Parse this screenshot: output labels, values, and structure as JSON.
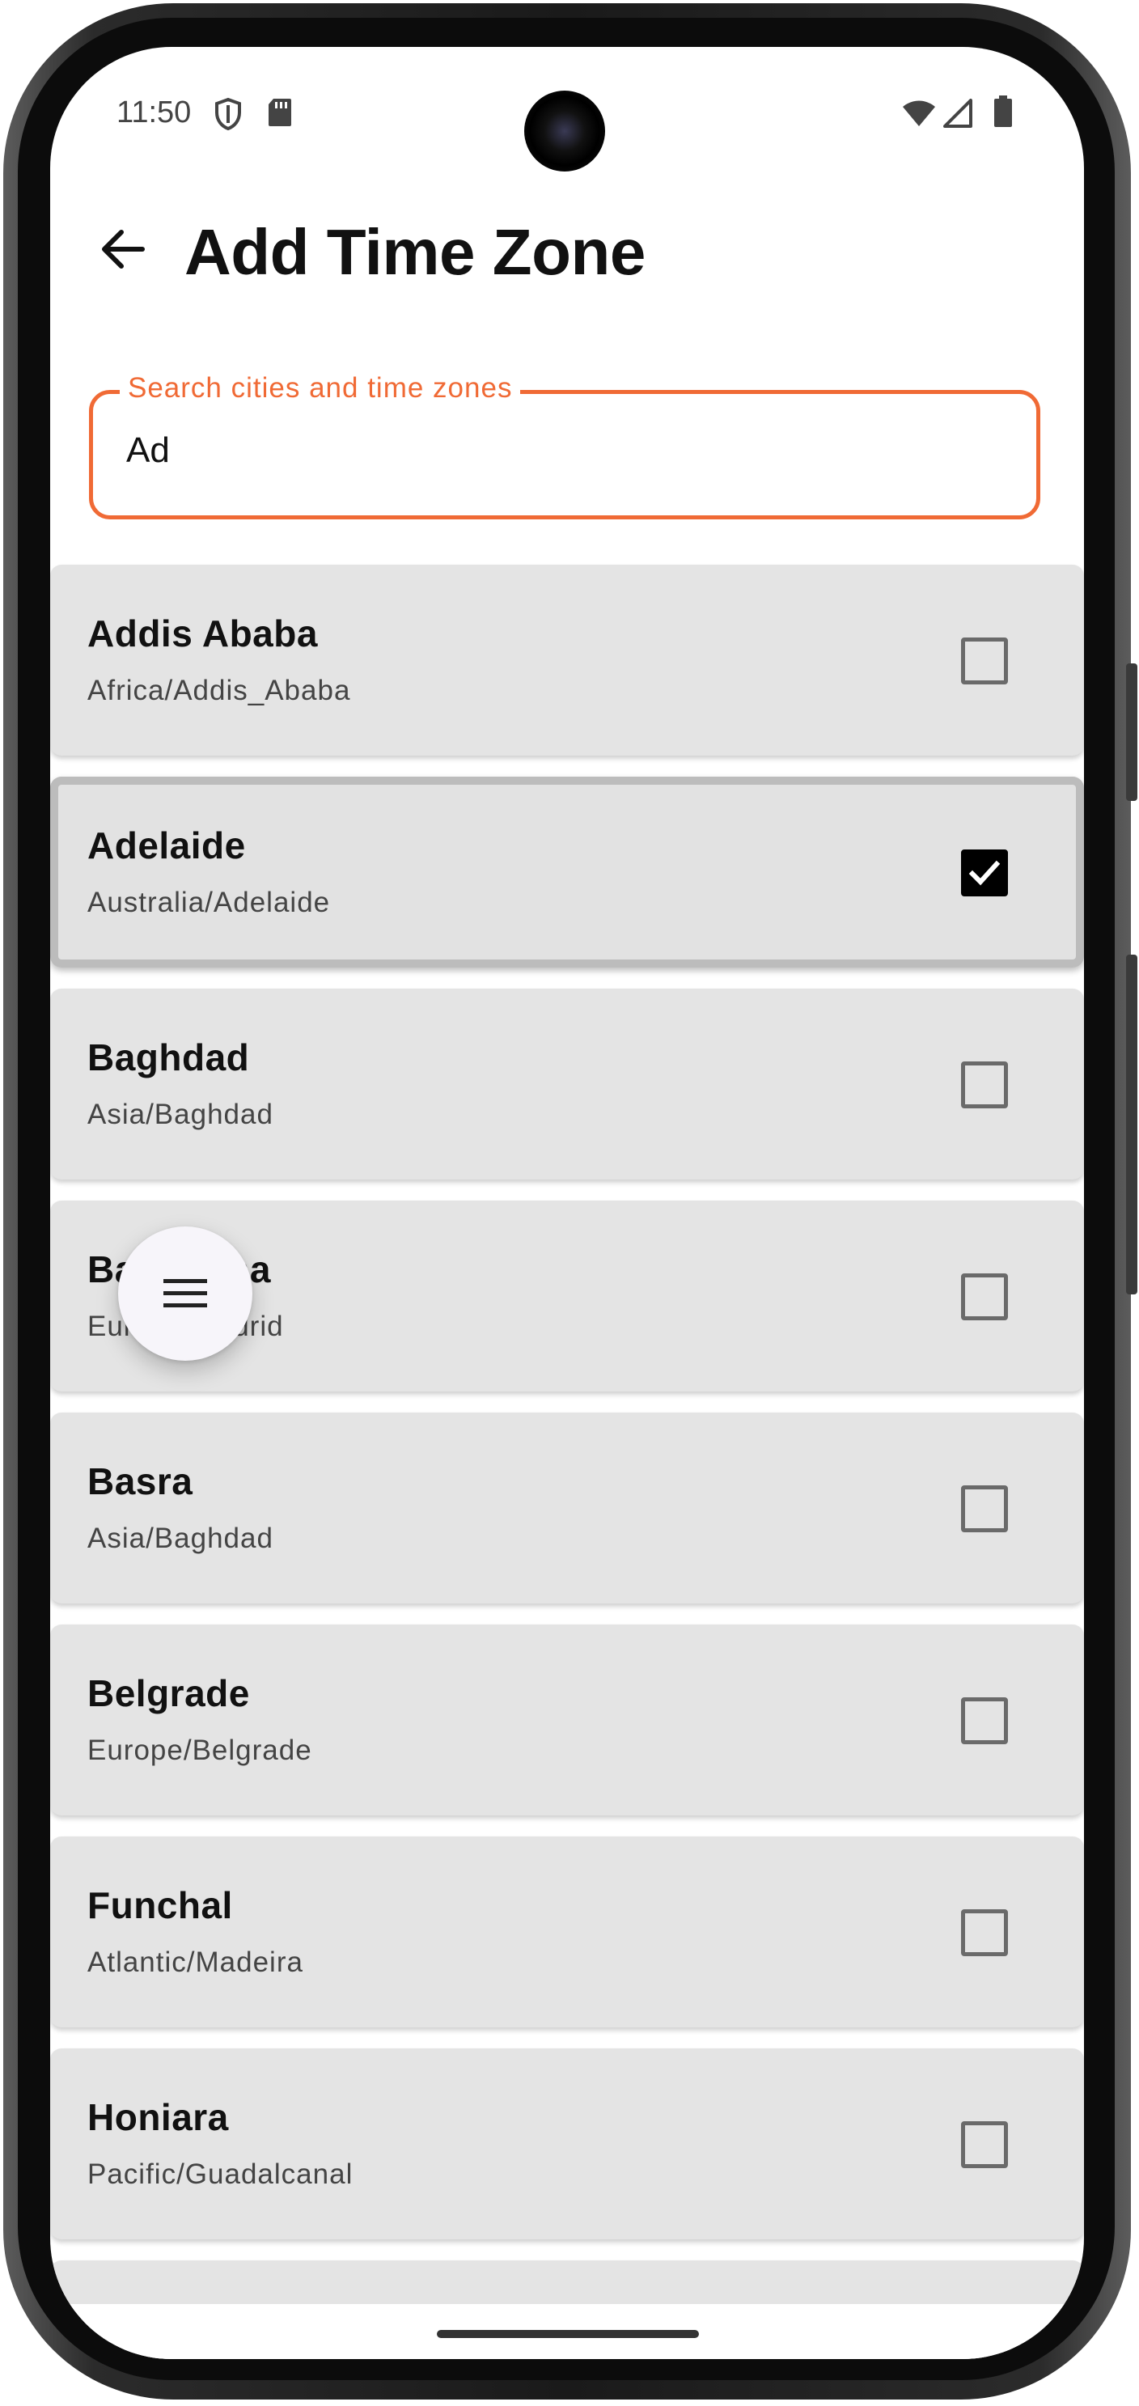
{
  "status_bar": {
    "time": "11:50",
    "icons": [
      "shield-icon",
      "sd-card-icon",
      "wifi-icon",
      "signal-icon",
      "battery-icon"
    ]
  },
  "header": {
    "title": "Add Time Zone",
    "back_icon": "arrow-back-icon"
  },
  "search": {
    "label": "Search cities and time zones",
    "value": "Ad"
  },
  "colors": {
    "accent": "#f06a35",
    "item_background": "#e4e4e4",
    "checkbox_checked": "#000000"
  },
  "time_zones": [
    {
      "city": "Addis Ababa",
      "zone": "Africa/Addis_Ababa",
      "checked": false
    },
    {
      "city": "Adelaide",
      "zone": "Australia/Adelaide",
      "checked": true
    },
    {
      "city": "Baghdad",
      "zone": "Asia/Baghdad",
      "checked": false
    },
    {
      "city": "Barcelona",
      "zone": "Europe/Madrid",
      "checked": false
    },
    {
      "city": "Basra",
      "zone": "Asia/Baghdad",
      "checked": false
    },
    {
      "city": "Belgrade",
      "zone": "Europe/Belgrade",
      "checked": false
    },
    {
      "city": "Funchal",
      "zone": "Atlantic/Madeira",
      "checked": false
    },
    {
      "city": "Honiara",
      "zone": "Pacific/Guadalcanal",
      "checked": false
    }
  ],
  "fab": {
    "icon": "menu-icon"
  }
}
